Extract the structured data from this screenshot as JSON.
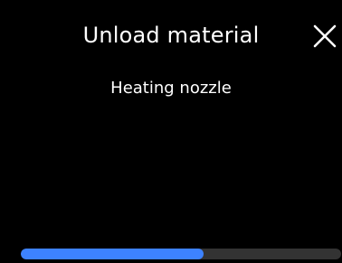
{
  "dialog": {
    "title": "Unload material",
    "status": "Heating nozzle",
    "close_icon": "close-icon",
    "progress": 0.57,
    "colors": {
      "background": "#000000",
      "text": "#ffffff",
      "progress_fill": "#3d82ff",
      "progress_track": "#333333"
    }
  }
}
